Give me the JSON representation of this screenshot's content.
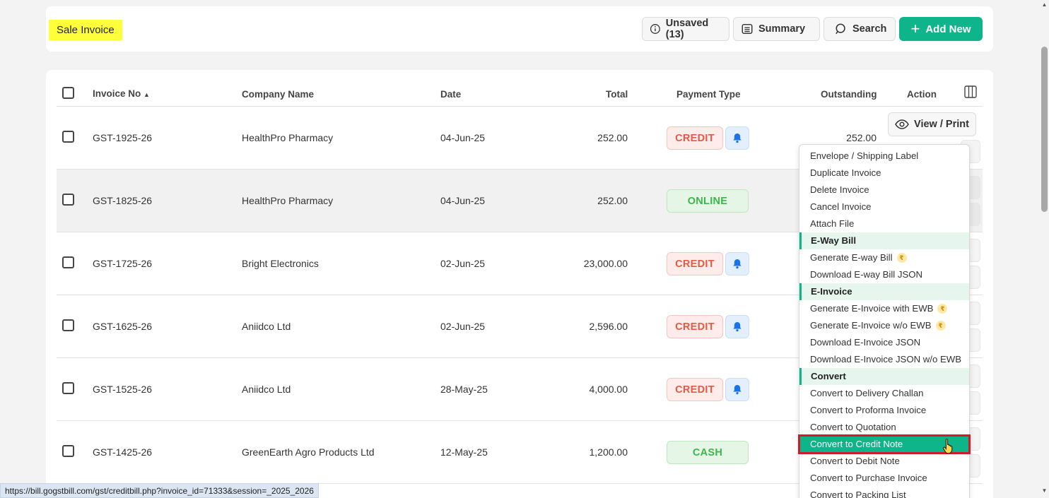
{
  "header": {
    "title": "Sale Invoice",
    "unsaved_label": "Unsaved (13)",
    "summary_label": "Summary",
    "search_label": "Search",
    "add_label": "Add New"
  },
  "table": {
    "columns": [
      "Invoice No",
      "Company Name",
      "Date",
      "Total",
      "Payment Type",
      "Outstanding",
      "Action"
    ],
    "rows": [
      {
        "invoice": "GST-1925-26",
        "company": "HealthPro Pharmacy",
        "date": "04-Jun-25",
        "total": "252.00",
        "payment": "CREDIT",
        "outstanding": "252.00"
      },
      {
        "invoice": "GST-1825-26",
        "company": "HealthPro Pharmacy",
        "date": "04-Jun-25",
        "total": "252.00",
        "payment": "ONLINE",
        "outstanding": ""
      },
      {
        "invoice": "GST-1725-26",
        "company": "Bright Electronics",
        "date": "02-Jun-25",
        "total": "23,000.00",
        "payment": "CREDIT",
        "outstanding": ""
      },
      {
        "invoice": "GST-1625-26",
        "company": "Aniidco Ltd",
        "date": "02-Jun-25",
        "total": "2,596.00",
        "payment": "CREDIT",
        "outstanding": ""
      },
      {
        "invoice": "GST-1525-26",
        "company": "Aniidco Ltd",
        "date": "28-May-25",
        "total": "4,000.00",
        "payment": "CREDIT",
        "outstanding": ""
      },
      {
        "invoice": "GST-1425-26",
        "company": "GreenEarth Agro Products Ltd",
        "date": "12-May-25",
        "total": "1,200.00",
        "payment": "CASH",
        "outstanding": ""
      }
    ]
  },
  "view_print_label": "View / Print",
  "menu": {
    "items": [
      "Envelope / Shipping Label",
      "Duplicate Invoice",
      "Delete Invoice",
      "Cancel Invoice",
      "Attach File"
    ],
    "eway_header": "E-Way Bill",
    "eway_items": [
      "Generate E-way Bill",
      "Download E-way Bill JSON"
    ],
    "einv_header": "E-Invoice",
    "einv_items": [
      "Generate E-Invoice with EWB",
      "Generate E-Invoice w/o EWB",
      "Download E-Invoice JSON",
      "Download E-Invoice JSON w/o EWB"
    ],
    "convert_header": "Convert",
    "convert_items": [
      "Convert to Delivery Challan",
      "Convert to Proforma Invoice",
      "Convert to Quotation",
      "Convert to Credit Note",
      "Convert to Debit Note",
      "Convert to Purchase Invoice",
      "Convert to Packing List"
    ]
  },
  "status_url": "https://bill.gogstbill.com/gst/creditbill.php?invoice_id=71333&session=_2025_2026",
  "colors": {
    "accent": "#0fb58a",
    "credit": "#e25a45",
    "online": "#3cb64a",
    "highlight": "#ffff3a"
  }
}
